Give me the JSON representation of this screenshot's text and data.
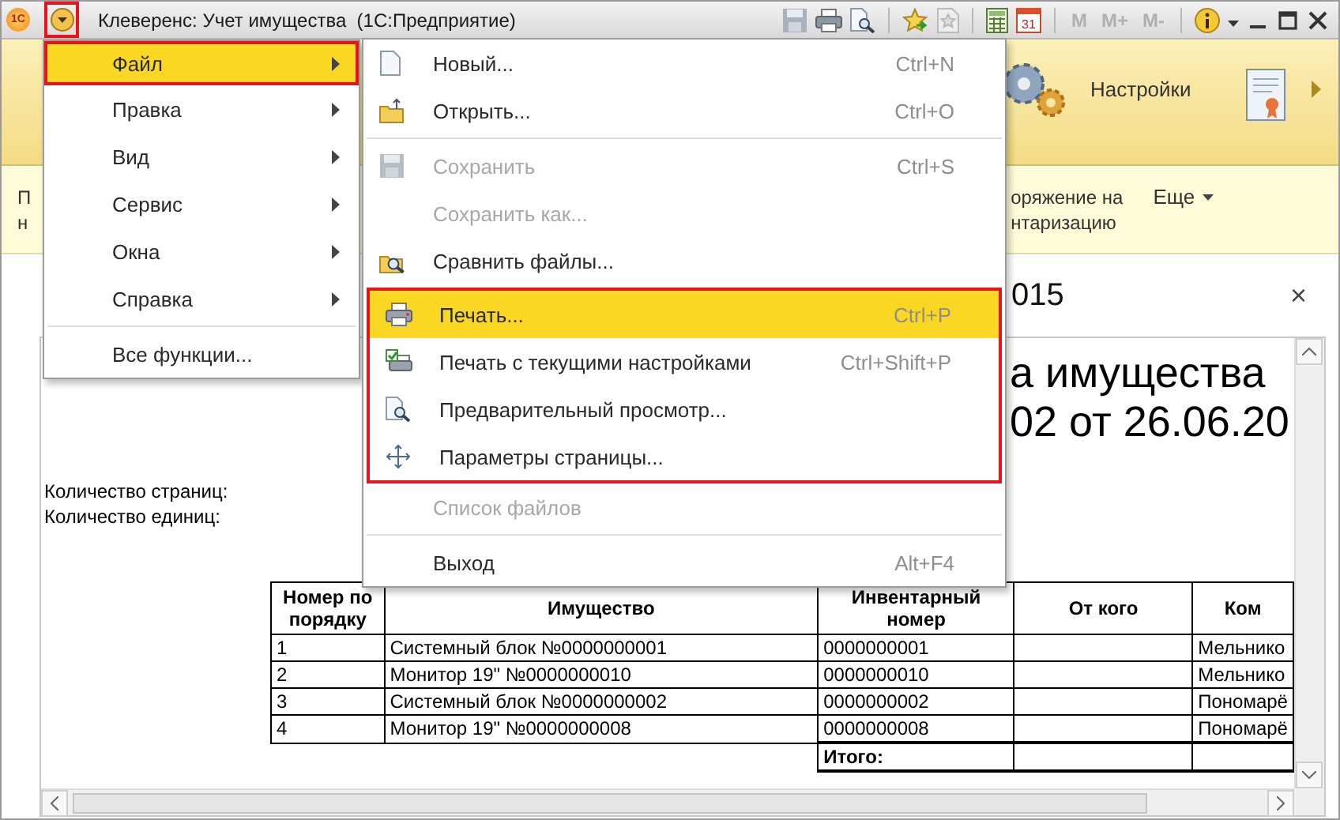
{
  "window": {
    "logo": "1С",
    "title": "Клеверенс: Учет имущества  (1С:Предприятие)",
    "menu_button": {
      "outlined": true
    }
  },
  "toolbar": {
    "calendar_day": "31",
    "memory_buttons": [
      {
        "label": "M",
        "disabled": true
      },
      {
        "label": "M+",
        "disabled": true
      },
      {
        "label": "M-",
        "disabled": true
      }
    ]
  },
  "sections": [
    {
      "label": "Настройки"
    }
  ],
  "commands": [
    {
      "lines": [
        "П",
        "н"
      ]
    },
    {
      "lines": [
        "оряжение на",
        "нтаризацию"
      ]
    }
  ],
  "more_button": {
    "label": "Еще"
  },
  "document": {
    "title": "015",
    "close": "×",
    "heading": [
      "а имущества",
      "02 от 26.06.20"
    ],
    "info": [
      "Количество страниц:",
      "Количество единиц:"
    ],
    "table": {
      "columns": [
        "Номер по порядку",
        "Имущество",
        "Инвентарный номер",
        "От кого",
        "Ком"
      ],
      "rows": [
        [
          "1",
          "Системный блок №0000000001",
          "0000000001",
          "",
          "Мельнико"
        ],
        [
          "2",
          "Монитор 19\" №0000000010",
          "0000000010",
          "",
          "Мельнико"
        ],
        [
          "3",
          "Системный блок №0000000002",
          "0000000002",
          "",
          "Пономарё"
        ],
        [
          "4",
          "Монитор 19\" №0000000008",
          "0000000008",
          "",
          "Пономарё"
        ]
      ],
      "total": {
        "label": "Итого:"
      }
    }
  },
  "main_menu": {
    "groups": [
      {
        "items": [
          {
            "label": "Файл",
            "selected": true,
            "outlined": true,
            "has_submenu": true
          },
          {
            "label": "Правка",
            "selected": false,
            "outlined": false,
            "has_submenu": true
          },
          {
            "label": "Вид",
            "selected": false,
            "outlined": false,
            "has_submenu": true
          },
          {
            "label": "Сервис",
            "selected": false,
            "outlined": false,
            "has_submenu": true
          },
          {
            "label": "Окна",
            "selected": false,
            "outlined": false,
            "has_submenu": true
          },
          {
            "label": "Справка",
            "selected": false,
            "outlined": false,
            "has_submenu": true
          }
        ]
      },
      {
        "items": [
          {
            "label": "Все функции...",
            "selected": false,
            "outlined": false,
            "has_submenu": false
          }
        ]
      }
    ]
  },
  "file_menu": {
    "groups": [
      {
        "separated": false,
        "outlined": false,
        "items": [
          {
            "label": "Новый...",
            "shortcut": "Ctrl+N",
            "disabled": false,
            "selected": false
          },
          {
            "label": "Открыть...",
            "shortcut": "Ctrl+O",
            "disabled": false,
            "selected": false
          }
        ]
      },
      {
        "separated": true,
        "outlined": false,
        "items": [
          {
            "label": "Сохранить",
            "shortcut": "Ctrl+S",
            "disabled": true,
            "selected": false
          },
          {
            "label": "Сохранить как...",
            "disabled": true,
            "selected": false
          },
          {
            "label": "Сравнить файлы...",
            "disabled": false,
            "selected": false
          }
        ]
      },
      {
        "separated": false,
        "outlined": true,
        "items": [
          {
            "label": "Печать...",
            "shortcut": "Ctrl+P",
            "disabled": false,
            "selected": true
          },
          {
            "label": "Печать с текущими настройками",
            "shortcut": "Ctrl+Shift+P",
            "disabled": false,
            "selected": false
          },
          {
            "label": "Предварительный просмотр...",
            "disabled": false,
            "selected": false
          },
          {
            "label": "Параметры страницы...",
            "disabled": false,
            "selected": false
          }
        ]
      },
      {
        "separated": false,
        "outlined": false,
        "items": [
          {
            "label": "Список файлов",
            "disabled": true,
            "selected": false
          }
        ]
      },
      {
        "separated": true,
        "outlined": false,
        "items": [
          {
            "label": "Выход",
            "shortcut": "Alt+F4",
            "disabled": false,
            "selected": false
          }
        ]
      }
    ]
  }
}
